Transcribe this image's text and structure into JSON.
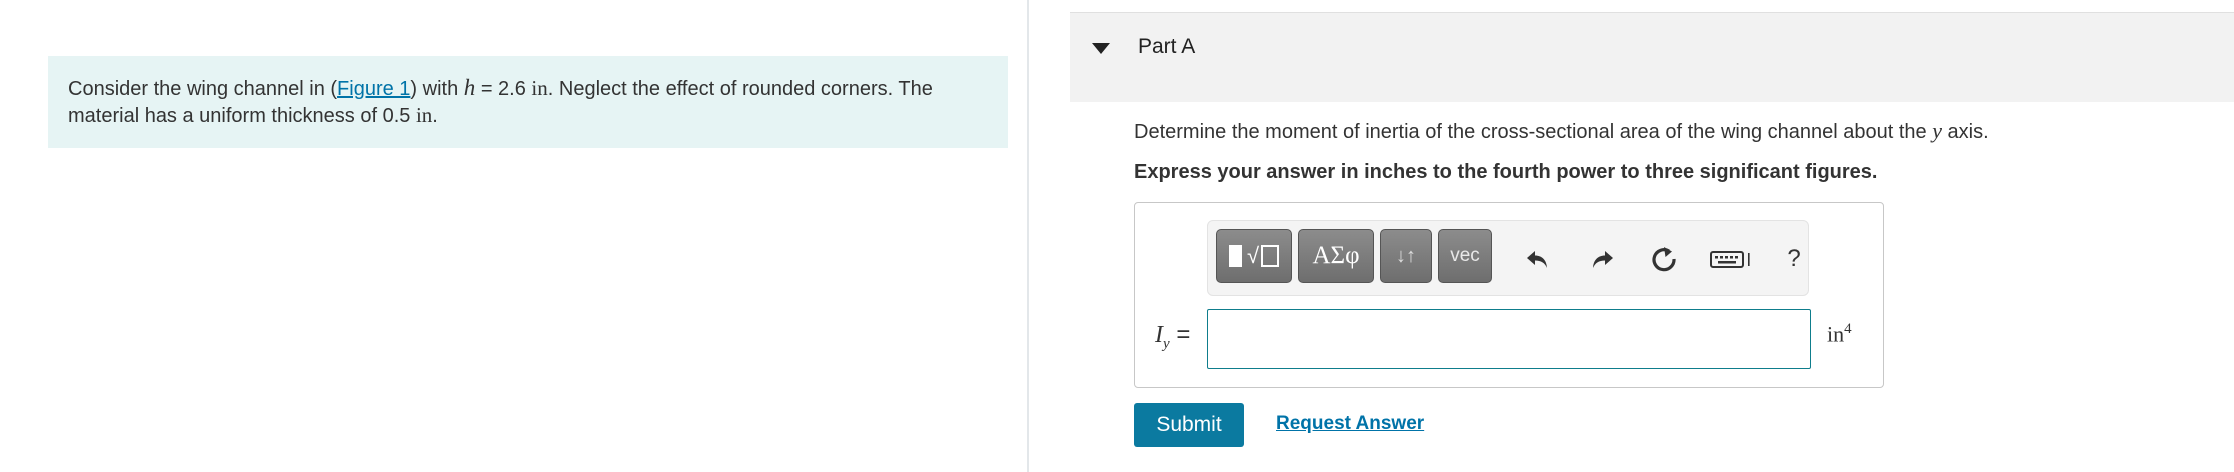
{
  "problem": {
    "text_before_link": "Consider the wing channel in (",
    "link_label": "Figure 1",
    "text_after_link": ") with ",
    "variable": "h",
    "equals_value": " = 2.6 ",
    "unit": "in",
    "text_rest_line1": ". Neglect the effect of rounded corners. The",
    "text_line2": "material has a uniform thickness of 0.5 ",
    "thickness_unit": "in",
    "line2_end": "."
  },
  "part": {
    "title": "Part A",
    "question_before": "Determine the moment of inertia of the cross-sectional area of the wing channel about the ",
    "question_axis": "y",
    "question_after": " axis.",
    "instruction": "Express your answer in inches to the fourth power to three significant figures."
  },
  "toolbar": {
    "templates_radical": "√",
    "greek_label": "ΑΣφ",
    "arrows_label": "↓↑",
    "vec_label": "vec",
    "help_label": "?",
    "icons": [
      "undo-icon",
      "redo-icon",
      "reset-icon",
      "keyboard-icon"
    ]
  },
  "answer": {
    "var_symbol": "I",
    "var_subscript": "y",
    "equals": " =",
    "value": "",
    "unit_base": "in",
    "unit_exponent": "4"
  },
  "actions": {
    "submit_label": "Submit",
    "request_label": "Request Answer"
  },
  "colors": {
    "problem_bg": "#e6f4f4",
    "link": "#0073a8",
    "submit_bg": "#0b7aa0",
    "input_border": "#0e7d8c"
  }
}
